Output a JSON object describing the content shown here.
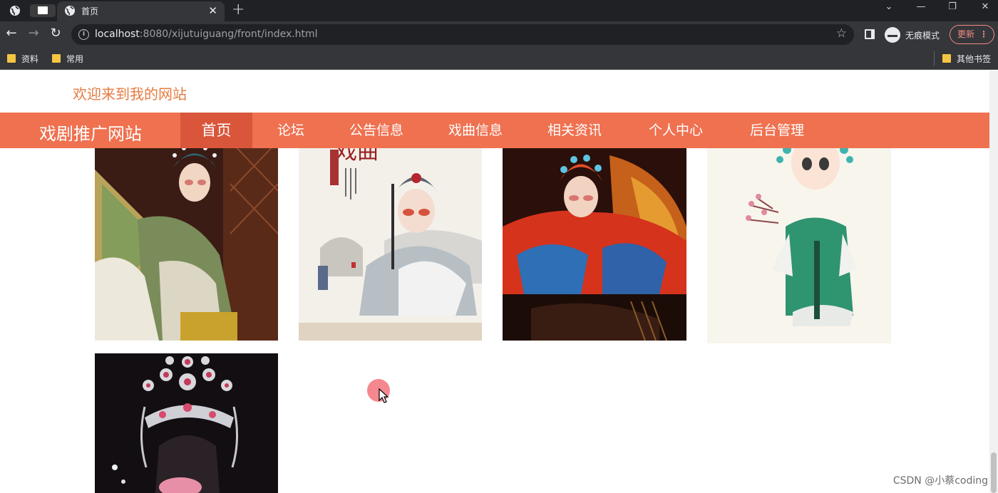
{
  "browser": {
    "tab_title": "首页",
    "url_host": "localhost",
    "url_rest": ":8080/xijutuiguang/front/index.html",
    "incognito_label": "无痕模式",
    "update_label": "更新",
    "bookmarks": [
      "资料",
      "常用"
    ],
    "other_bookmarks": "其他书签"
  },
  "site": {
    "welcome": "欢迎来到我的网站",
    "brand": "戏剧推广网站",
    "nav": [
      {
        "label": "首页",
        "active": true
      },
      {
        "label": "论坛"
      },
      {
        "label": "公告信息"
      },
      {
        "label": "戏曲信息"
      },
      {
        "label": "相关资讯"
      },
      {
        "label": "个人中心"
      },
      {
        "label": "后台管理"
      }
    ]
  },
  "gallery": {
    "poster_calligraphy": "戏曲"
  },
  "watermark": "CSDN @小蔡coding",
  "colors": {
    "nav_bg": "#ef7150",
    "nav_active": "#d9563a",
    "welcome_text": "#e67b40"
  }
}
